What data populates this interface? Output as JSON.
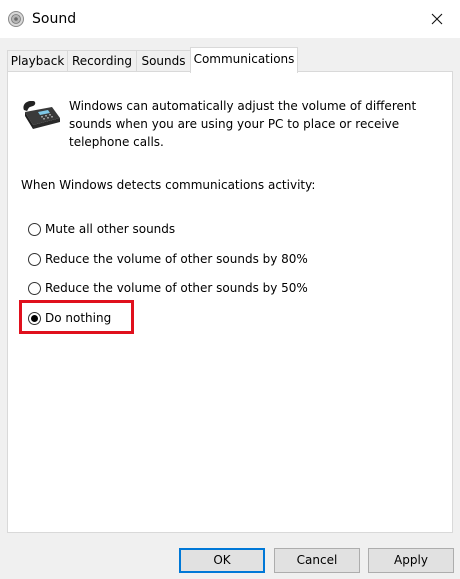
{
  "window": {
    "title": "Sound"
  },
  "tabs": [
    {
      "label": "Playback",
      "active": false
    },
    {
      "label": "Recording",
      "active": false
    },
    {
      "label": "Sounds",
      "active": false
    },
    {
      "label": "Communications",
      "active": true
    }
  ],
  "communications": {
    "description": "Windows can automatically adjust the volume of different sounds when you are using your PC to place or receive telephone calls.",
    "detect_label": "When Windows detects communications activity:",
    "options": [
      {
        "label": "Mute all other sounds",
        "selected": false
      },
      {
        "label": "Reduce the volume of other sounds by 80%",
        "selected": false
      },
      {
        "label": "Reduce the volume of other sounds by 50%",
        "selected": false
      },
      {
        "label": "Do nothing",
        "selected": true
      }
    ]
  },
  "buttons": {
    "ok": "OK",
    "cancel": "Cancel",
    "apply": "Apply"
  },
  "colors": {
    "highlight": "#e0101d",
    "focus_border": "#0078d7"
  },
  "icons": {
    "title": "speaker-icon",
    "close": "close-icon",
    "communications": "telephone-icon"
  }
}
